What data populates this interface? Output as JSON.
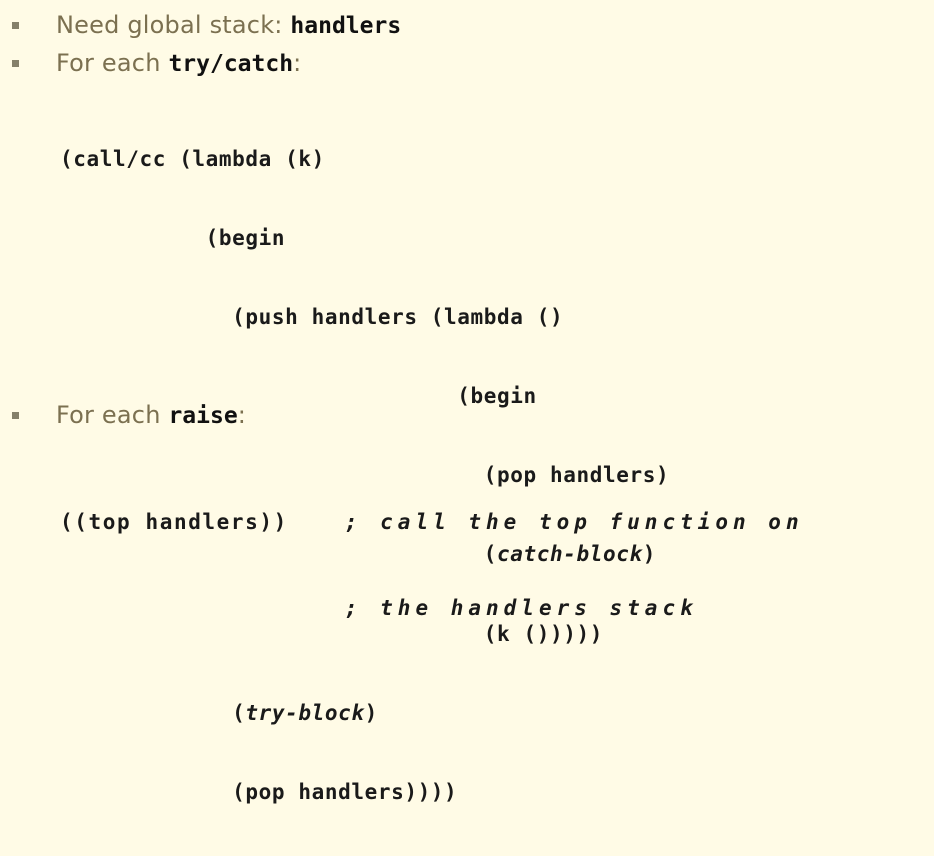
{
  "bullets": [
    {
      "text": "Need global stack: ",
      "code": "handlers",
      "suffix": ""
    },
    {
      "text": "For each ",
      "code": "try/catch",
      "suffix": ":"
    },
    {
      "text": "For each ",
      "code": "raise",
      "suffix": ":"
    }
  ],
  "code_block_1": {
    "lines": [
      {
        "plain": "(call/cc (lambda (k)"
      },
      {
        "plain": "           (begin"
      },
      {
        "plain": "             (push handlers (lambda ()"
      },
      {
        "plain": "                              (begin"
      },
      {
        "plain": "                                (pop handlers)"
      },
      {
        "pre": "                                (",
        "italic": "catch-block",
        "post": ")"
      },
      {
        "plain": "                                (k ()))))"
      },
      {
        "pre": "             (",
        "italic": "try-block",
        "post": ")"
      },
      {
        "plain": "             (pop handlers))))"
      }
    ]
  },
  "code_block_2": {
    "lines": [
      {
        "pre": "((top handlers))    ",
        "comment": "; call the top function on"
      },
      {
        "pre": "                    ",
        "comment": "; the handlers stack"
      }
    ]
  },
  "colors": {
    "background": "#fffbe6",
    "bullet_text": "#7b7050",
    "bullet_marker": "#85806a",
    "code": "#1a1a1a"
  }
}
